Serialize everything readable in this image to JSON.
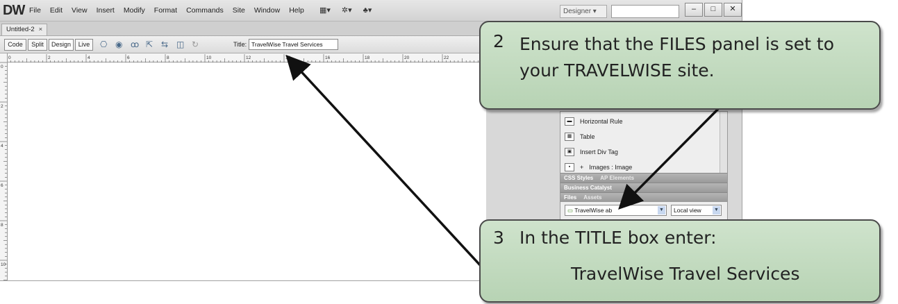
{
  "app": {
    "logo": "DW",
    "menu": [
      "File",
      "Edit",
      "View",
      "Insert",
      "Modify",
      "Format",
      "Commands",
      "Site",
      "Window",
      "Help"
    ],
    "workspace": "Designer",
    "window_buttons": [
      "–",
      "□",
      "✕"
    ]
  },
  "document": {
    "tab_label": "Untitled-2",
    "tab_close": "×",
    "view_buttons": [
      "Code",
      "Split",
      "Design",
      "Live"
    ],
    "title_label": "Title:",
    "title_value": "TravelWise Travel Services"
  },
  "ruler": {
    "h_ticks": [
      "0",
      "2",
      "4",
      "6",
      "8",
      "10",
      "12",
      "14",
      "16",
      "18",
      "20",
      "22"
    ],
    "v_ticks": [
      "0",
      "2",
      "4",
      "6",
      "8",
      "10"
    ]
  },
  "insert_panel": {
    "items": [
      "Horizontal Rule",
      "Table",
      "Insert Div Tag",
      "Images : Image"
    ]
  },
  "panel_groups": {
    "css_tabs": [
      "CSS Styles",
      "AP Elements"
    ],
    "business_catalyst": "Business Catalyst",
    "files_tabs": [
      "Files",
      "Assets"
    ],
    "site_select": "TravelWise ab",
    "view_select": "Local view"
  },
  "callouts": {
    "step2_number": "2",
    "step2_text": "Ensure that the FILES panel is set to your TRAVELWISE site.",
    "step3_number": "3",
    "step3_text": "In the TITLE box enter:",
    "step3_entry": "TravelWise Travel Services"
  }
}
